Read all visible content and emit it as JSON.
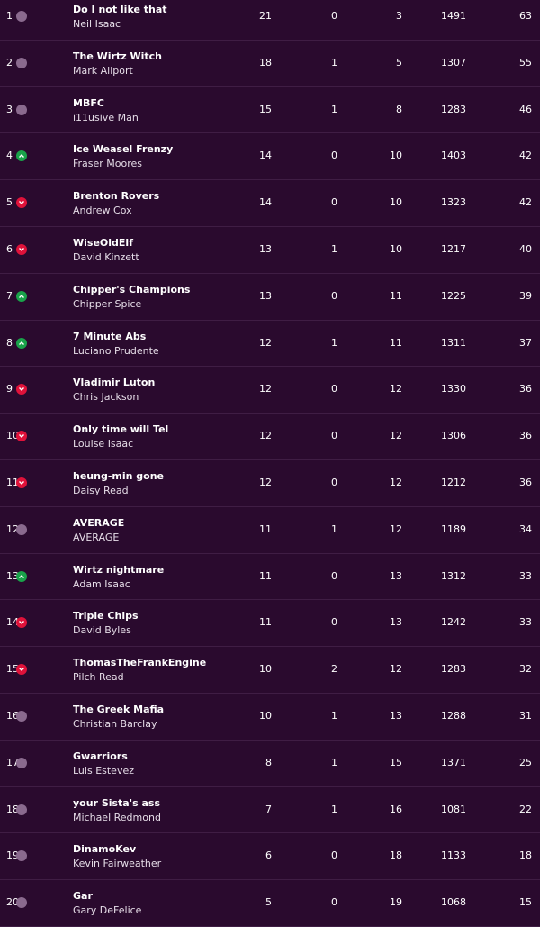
{
  "standings": [
    {
      "rank": "1",
      "movement": "same",
      "team": "Do I not like that",
      "manager": "Neil Isaac",
      "won": "21",
      "drawn": "0",
      "lost": "3",
      "points_for": "1491",
      "pts": "63"
    },
    {
      "rank": "2",
      "movement": "same",
      "team": "The Wirtz Witch",
      "manager": "Mark Allport",
      "won": "18",
      "drawn": "1",
      "lost": "5",
      "points_for": "1307",
      "pts": "55"
    },
    {
      "rank": "3",
      "movement": "same",
      "team": "MBFC",
      "manager": "i11usive Man",
      "won": "15",
      "drawn": "1",
      "lost": "8",
      "points_for": "1283",
      "pts": "46"
    },
    {
      "rank": "4",
      "movement": "up",
      "team": "Ice Weasel Frenzy",
      "manager": "Fraser Moores",
      "won": "14",
      "drawn": "0",
      "lost": "10",
      "points_for": "1403",
      "pts": "42"
    },
    {
      "rank": "5",
      "movement": "down",
      "team": "Brenton Rovers",
      "manager": "Andrew Cox",
      "won": "14",
      "drawn": "0",
      "lost": "10",
      "points_for": "1323",
      "pts": "42"
    },
    {
      "rank": "6",
      "movement": "down",
      "team": "WiseOldElf",
      "manager": "David Kinzett",
      "won": "13",
      "drawn": "1",
      "lost": "10",
      "points_for": "1217",
      "pts": "40"
    },
    {
      "rank": "7",
      "movement": "up",
      "team": "Chipper's Champions",
      "manager": "Chipper Spice",
      "won": "13",
      "drawn": "0",
      "lost": "11",
      "points_for": "1225",
      "pts": "39"
    },
    {
      "rank": "8",
      "movement": "up",
      "team": "7 Minute Abs",
      "manager": "Luciano Prudente",
      "won": "12",
      "drawn": "1",
      "lost": "11",
      "points_for": "1311",
      "pts": "37"
    },
    {
      "rank": "9",
      "movement": "down",
      "team": "Vladimir Luton",
      "manager": "Chris Jackson",
      "won": "12",
      "drawn": "0",
      "lost": "12",
      "points_for": "1330",
      "pts": "36"
    },
    {
      "rank": "10",
      "movement": "down",
      "team": "Only time will Tel",
      "manager": "Louise Isaac",
      "won": "12",
      "drawn": "0",
      "lost": "12",
      "points_for": "1306",
      "pts": "36"
    },
    {
      "rank": "11",
      "movement": "down",
      "team": "heung-min gone",
      "manager": "Daisy Read",
      "won": "12",
      "drawn": "0",
      "lost": "12",
      "points_for": "1212",
      "pts": "36"
    },
    {
      "rank": "12",
      "movement": "same",
      "team": "AVERAGE",
      "manager": "AVERAGE",
      "won": "11",
      "drawn": "1",
      "lost": "12",
      "points_for": "1189",
      "pts": "34"
    },
    {
      "rank": "13",
      "movement": "up",
      "team": "Wirtz nightmare",
      "manager": "Adam Isaac",
      "won": "11",
      "drawn": "0",
      "lost": "13",
      "points_for": "1312",
      "pts": "33"
    },
    {
      "rank": "14",
      "movement": "down",
      "team": "Triple Chips",
      "manager": "David Byles",
      "won": "11",
      "drawn": "0",
      "lost": "13",
      "points_for": "1242",
      "pts": "33"
    },
    {
      "rank": "15",
      "movement": "down",
      "team": "ThomasTheFrankEngine",
      "manager": "Pilch Read",
      "won": "10",
      "drawn": "2",
      "lost": "12",
      "points_for": "1283",
      "pts": "32"
    },
    {
      "rank": "16",
      "movement": "same",
      "team": "The Greek Mafia",
      "manager": "Christian Barclay",
      "won": "10",
      "drawn": "1",
      "lost": "13",
      "points_for": "1288",
      "pts": "31"
    },
    {
      "rank": "17",
      "movement": "same",
      "team": "Gwarriors",
      "manager": "Luis Estevez",
      "won": "8",
      "drawn": "1",
      "lost": "15",
      "points_for": "1371",
      "pts": "25"
    },
    {
      "rank": "18",
      "movement": "same",
      "team": "your Sista's ass",
      "manager": "Michael Redmond",
      "won": "7",
      "drawn": "1",
      "lost": "16",
      "points_for": "1081",
      "pts": "22"
    },
    {
      "rank": "19",
      "movement": "same",
      "team": "DinamoKev",
      "manager": "Kevin Fairweather",
      "won": "6",
      "drawn": "0",
      "lost": "18",
      "points_for": "1133",
      "pts": "18"
    },
    {
      "rank": "20",
      "movement": "same",
      "team": "Gar",
      "manager": "Gary DeFelice",
      "won": "5",
      "drawn": "0",
      "lost": "19",
      "points_for": "1068",
      "pts": "15"
    }
  ],
  "colors": {
    "background": "#2a0a2e",
    "row_divider": "#3f1d44",
    "movement_up": "#19a34a",
    "movement_down": "#e0123a",
    "movement_same": "#8a6a8e"
  }
}
